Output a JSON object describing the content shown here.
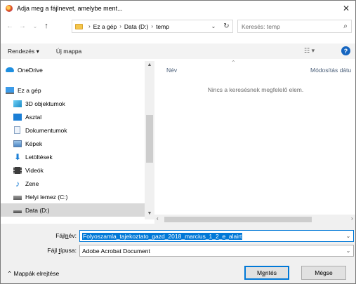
{
  "window": {
    "title": "Adja meg a fájlnevet, amelybe ment...",
    "close": "✕"
  },
  "toolbar": {
    "back_icon": "←",
    "forward_icon": "→",
    "recent_icon": "⌄",
    "up_icon": "↑",
    "address": {
      "crumbs": [
        "Ez a gép",
        "Data (D:)",
        "temp"
      ]
    },
    "search_placeholder": "Keresés: temp"
  },
  "commandbar": {
    "organize": "Rendezés ▾",
    "new_folder": "Új mappa",
    "view": "☷ ▾",
    "help": "?"
  },
  "nav": {
    "items": [
      {
        "label": "OneDrive",
        "icon": "cloud-icon",
        "level": 0,
        "selected": false
      },
      {
        "label": "Ez a gép",
        "icon": "computer-icon",
        "level": 0,
        "selected": false
      },
      {
        "label": "3D objektumok",
        "icon": "3d-objects-icon",
        "level": 1,
        "selected": false
      },
      {
        "label": "Asztal",
        "icon": "desktop-icon",
        "level": 1,
        "selected": false
      },
      {
        "label": "Dokumentumok",
        "icon": "documents-icon",
        "level": 1,
        "selected": false
      },
      {
        "label": "Képek",
        "icon": "pictures-icon",
        "level": 1,
        "selected": false
      },
      {
        "label": "Letöltések",
        "icon": "downloads-icon",
        "level": 1,
        "selected": false
      },
      {
        "label": "Videók",
        "icon": "videos-icon",
        "level": 1,
        "selected": false
      },
      {
        "label": "Zene",
        "icon": "music-icon",
        "level": 1,
        "selected": false
      },
      {
        "label": "Helyi lemez (C:)",
        "icon": "drive-icon",
        "level": 1,
        "selected": false
      },
      {
        "label": "Data (D:)",
        "icon": "drive-icon",
        "level": 1,
        "selected": true
      }
    ]
  },
  "content": {
    "columns": {
      "name": "Név",
      "modified": "Módosítás dátu"
    },
    "empty_message": "Nincs a keresésnek megfelelő elem."
  },
  "form": {
    "filename_label_pre": "Fájl",
    "filename_label_u": "n",
    "filename_label_post": "év:",
    "filename_value": "Folyoszamla_tajekoztato_gazd_2018_marcius_1_2_e_alairt",
    "filetype_label_pre": "Fájl ",
    "filetype_label_u": "t",
    "filetype_label_post": "ípusa:",
    "filetype_value": "Adobe Acrobat Document",
    "hide_folders": "Mappák elrejtése",
    "save_pre": "M",
    "save_u": "e",
    "save_post": "ntés",
    "cancel": "Mégse"
  }
}
